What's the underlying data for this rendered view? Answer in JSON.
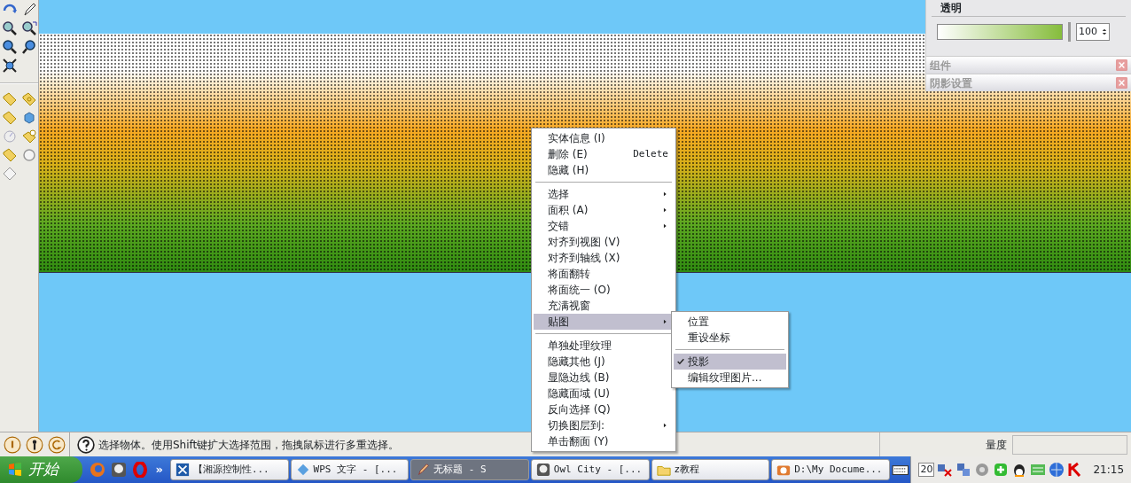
{
  "panel": {
    "title": "透明",
    "slider": {
      "level": 1.0
    },
    "value": "100",
    "sections": [
      {
        "title": "组件"
      },
      {
        "title": "阴影设置"
      }
    ]
  },
  "context_menu": [
    {
      "kind": "item",
      "label": "实体信息 (I)",
      "submenu": false,
      "selected": false
    },
    {
      "kind": "item",
      "label": "删除 (E)",
      "shortcut": "Delete",
      "submenu": false,
      "selected": false
    },
    {
      "kind": "item",
      "label": "隐藏 (H)",
      "submenu": false,
      "selected": false
    },
    {
      "kind": "separator"
    },
    {
      "kind": "item",
      "label": "选择",
      "submenu": true,
      "selected": false
    },
    {
      "kind": "item",
      "label": "面积 (A)",
      "submenu": true,
      "selected": false
    },
    {
      "kind": "item",
      "label": "交错",
      "submenu": true,
      "selected": false
    },
    {
      "kind": "item",
      "label": "对齐到视图 (V)",
      "submenu": false,
      "selected": false
    },
    {
      "kind": "item",
      "label": "对齐到轴线 (X)",
      "submenu": false,
      "selected": false
    },
    {
      "kind": "item",
      "label": "将面翻转",
      "submenu": false,
      "selected": false
    },
    {
      "kind": "item",
      "label": "将面统一 (O)",
      "submenu": false,
      "selected": false
    },
    {
      "kind": "item",
      "label": "充满视窗",
      "submenu": false,
      "selected": false
    },
    {
      "kind": "item",
      "label": "贴图",
      "submenu": true,
      "selected": true
    },
    {
      "kind": "separator"
    },
    {
      "kind": "item",
      "label": "单独处理纹理",
      "submenu": false,
      "selected": false
    },
    {
      "kind": "item",
      "label": "隐藏其他 (J)",
      "submenu": false,
      "selected": false
    },
    {
      "kind": "item",
      "label": "显隐边线 (B)",
      "submenu": false,
      "selected": false
    },
    {
      "kind": "item",
      "label": "隐藏面域 (U)",
      "submenu": false,
      "selected": false
    },
    {
      "kind": "item",
      "label": "反向选择 (Q)",
      "submenu": false,
      "selected": false
    },
    {
      "kind": "item",
      "label": "切换图层到:",
      "submenu": true,
      "selected": false
    },
    {
      "kind": "item",
      "label": "单击翻面 (Y)",
      "submenu": false,
      "selected": false
    }
  ],
  "submenu": [
    {
      "kind": "item",
      "label": "位置",
      "checked": false,
      "selected": false
    },
    {
      "kind": "item",
      "label": "重设坐标",
      "checked": false,
      "selected": false
    },
    {
      "kind": "separator"
    },
    {
      "kind": "item",
      "label": "投影",
      "checked": true,
      "selected": true
    },
    {
      "kind": "item",
      "label": "编辑纹理图片...",
      "checked": false,
      "selected": false
    }
  ],
  "status_bar": {
    "text": "选择物体。使用Shift键扩大选择范围，拖拽鼠标进行多重选择。",
    "measure_label": "量度"
  },
  "taskbar": {
    "start": "开始",
    "more": "»",
    "tasks": [
      {
        "label": "【湘源控制性...",
        "selected": false
      },
      {
        "label": "WPS 文字 - [...",
        "selected": false
      },
      {
        "label": "无标题 - S",
        "selected": true
      },
      {
        "label": "Owl City - [...",
        "selected": false
      },
      {
        "label": "z教程",
        "selected": false
      },
      {
        "label": "D:\\My Docume...",
        "selected": false
      }
    ],
    "calendar": "20",
    "clock": "21:15"
  }
}
